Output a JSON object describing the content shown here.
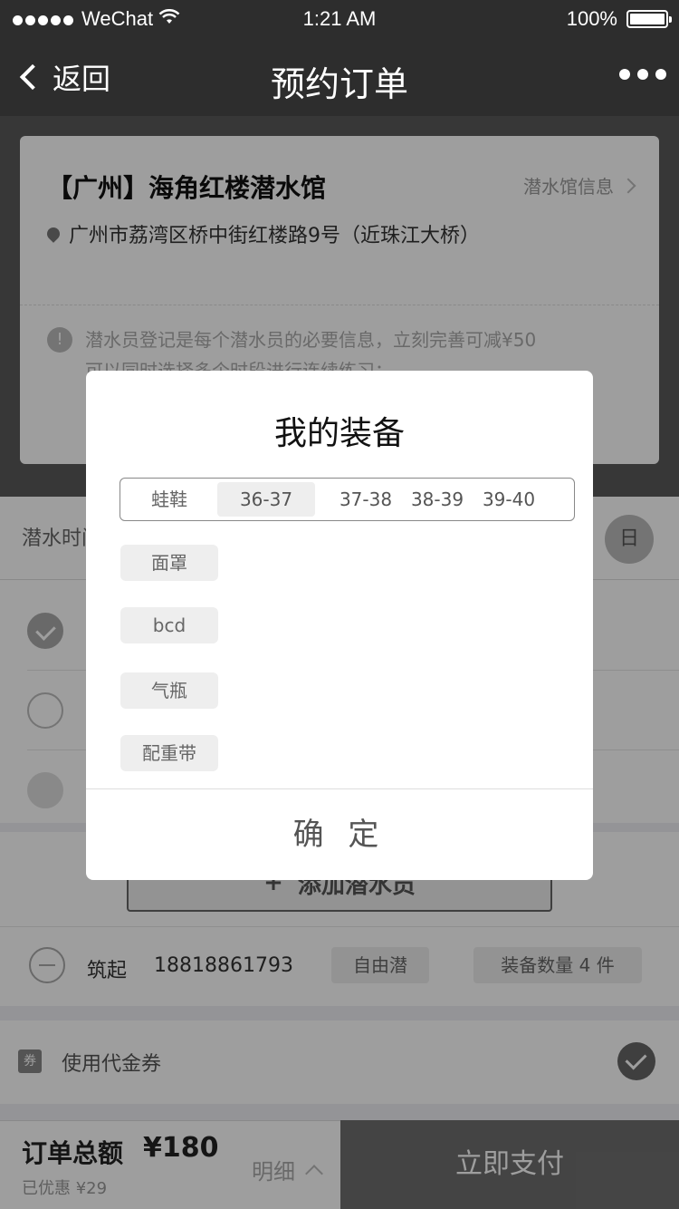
{
  "status_bar": {
    "carrier": "WeChat",
    "time": "1:21 AM",
    "battery": "100%"
  },
  "nav": {
    "back_label": "返回",
    "title": "预约订单"
  },
  "venue": {
    "name": "【广州】海角红楼潜水馆",
    "info_link": "潜水馆信息",
    "address": "广州市荔湾区桥中街红楼路9号（近珠江大桥）",
    "notice_line1": "潜水员登记是每个潜水员的必要信息，立刻完善可减¥50",
    "notice_line2": "可以同时选择多个时段进行连续练习："
  },
  "dive_time": {
    "label": "潜水时间",
    "day_label": "日"
  },
  "add_diver": {
    "label": "添加潜水员"
  },
  "diver": {
    "name": "筑起",
    "phone": "18818861793",
    "type_tag": "自由潜",
    "equipment_tag": "装备数量 4 件"
  },
  "voucher": {
    "icon_text": "券",
    "label": "使用代金券"
  },
  "footer": {
    "total_label": "订单总额",
    "total_price": "¥180",
    "discount": "已优惠 ¥29",
    "detail_label": "明细",
    "pay_label": "立即支付"
  },
  "modal": {
    "title": "我的装备",
    "fins_label": "蛙鞋",
    "fin_sizes": [
      "36-37",
      "37-38",
      "38-39",
      "39-40"
    ],
    "selected_fin_size": "36-37",
    "equipment": [
      "面罩",
      "bcd",
      "气瓶",
      "配重带"
    ],
    "confirm_label": "确 定"
  },
  "colors": {
    "nav_background": "#2d2d2d",
    "pay_button": "#6f6f6f",
    "chip_background": "#eeeeee"
  }
}
